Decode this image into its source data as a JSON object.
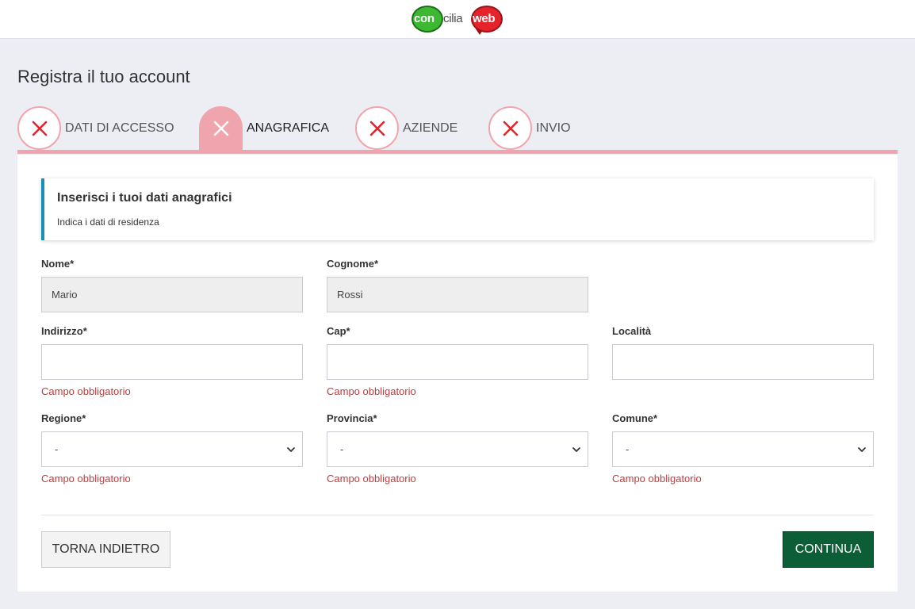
{
  "header": {
    "logo": {
      "part1": "con",
      "part2": "cilia",
      "part3": "web"
    }
  },
  "page": {
    "title": "Registra il tuo account"
  },
  "steps": [
    {
      "label": "DATI DI ACCESSO",
      "status": "error",
      "active": false
    },
    {
      "label": "ANAGRAFICA",
      "status": "error",
      "active": true
    },
    {
      "label": "AZIENDE",
      "status": "error",
      "active": false
    },
    {
      "label": "INVIO",
      "status": "error",
      "active": false
    }
  ],
  "info": {
    "title": "Inserisci i tuoi dati anagrafici",
    "subtitle": "Indica i dati di residenza"
  },
  "form": {
    "nome": {
      "label": "Nome*",
      "value": "Mario"
    },
    "cognome": {
      "label": "Cognome*",
      "value": "Rossi"
    },
    "indirizzo": {
      "label": "Indirizzo*",
      "value": "",
      "error": "Campo obbligatorio"
    },
    "cap": {
      "label": "Cap*",
      "value": "",
      "error": "Campo obbligatorio"
    },
    "localita": {
      "label": "Località",
      "value": ""
    },
    "regione": {
      "label": "Regione*",
      "selected": "-",
      "error": "Campo obbligatorio"
    },
    "provincia": {
      "label": "Provincia*",
      "selected": "-",
      "error": "Campo obbligatorio"
    },
    "comune": {
      "label": "Comune*",
      "selected": "-",
      "error": "Campo obbligatorio"
    }
  },
  "actions": {
    "back_label": "TORNA INDIETRO",
    "next_label": "CONTINUA"
  },
  "colors": {
    "accent_pink": "#f0a4ad",
    "error_red": "#e5232b",
    "info_blue": "#1a8fb5",
    "primary_green": "#0b5e35"
  }
}
